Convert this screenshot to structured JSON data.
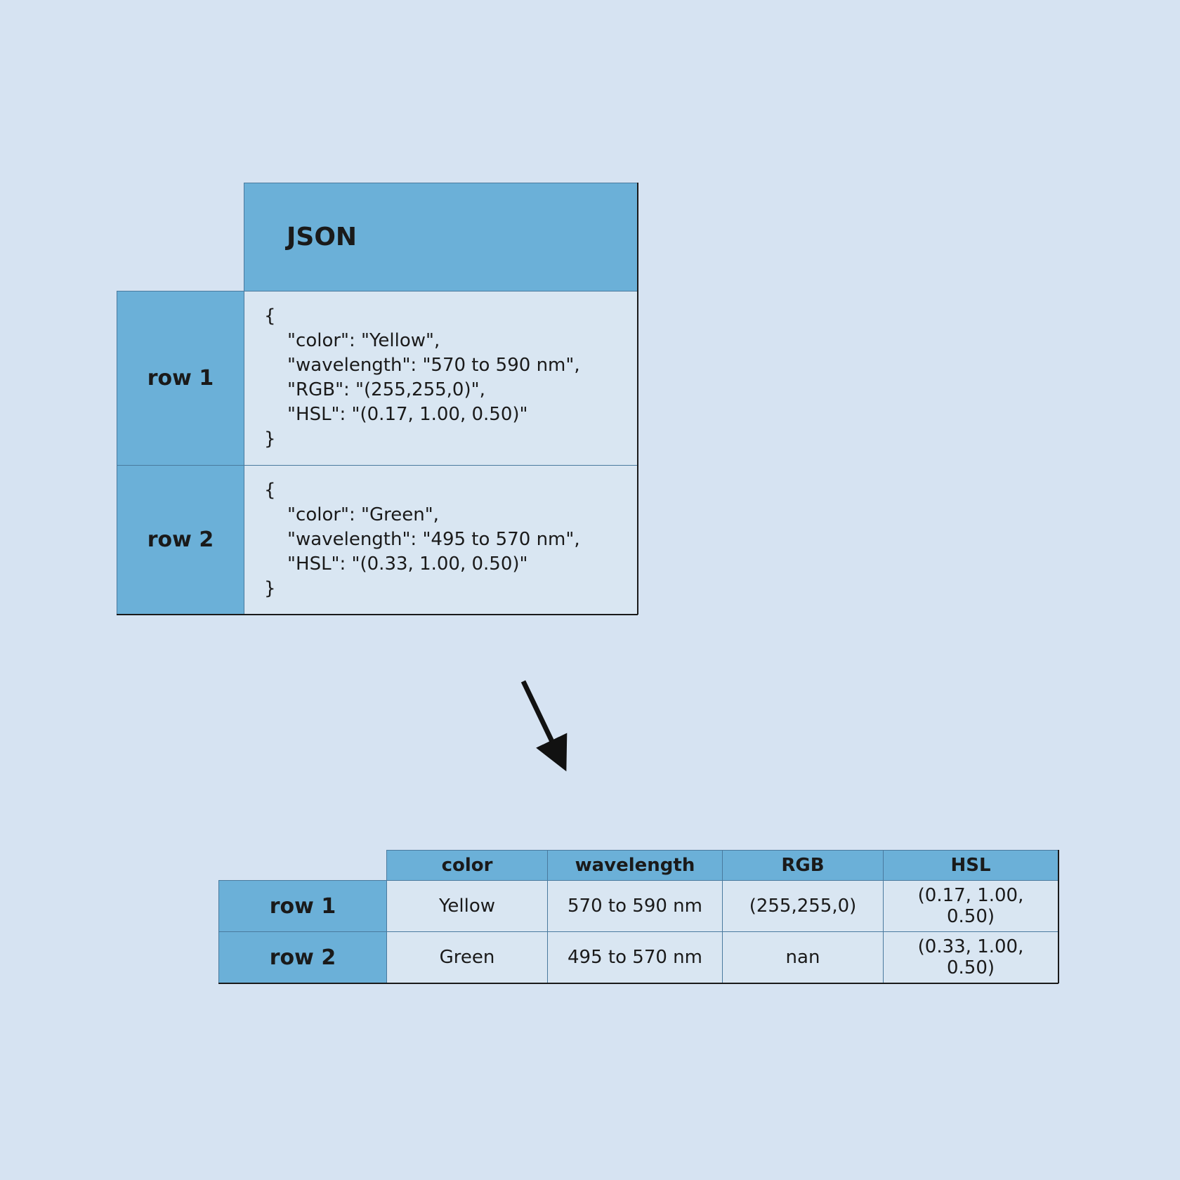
{
  "json_table": {
    "header": "JSON",
    "rows": [
      {
        "label": "row 1",
        "text": "{\n    \"color\": \"Yellow\",\n    \"wavelength\": \"570 to 590 nm\",\n    \"RGB\": \"(255,255,0)\",\n    \"HSL\": \"(0.17, 1.00, 0.50)\"\n}"
      },
      {
        "label": "row 2",
        "text": "{\n    \"color\": \"Green\",\n    \"wavelength\": \"495 to 570 nm\",\n    \"HSL\": \"(0.33, 1.00, 0.50)\"\n}"
      }
    ]
  },
  "out_table": {
    "columns": [
      "color",
      "wavelength",
      "RGB",
      "HSL"
    ],
    "rows": [
      {
        "label": "row 1",
        "cells": [
          "Yellow",
          "570 to 590 nm",
          "(255,255,0)",
          "(0.17, 1.00, 0.50)"
        ]
      },
      {
        "label": "row 2",
        "cells": [
          "Green",
          "495 to 570 nm",
          "nan",
          "(0.33, 1.00, 0.50)"
        ]
      }
    ]
  },
  "colors": {
    "page_bg": "#d6e3f2",
    "header_bg": "#6bb0d8",
    "cell_bg": "#d9e6f2",
    "border": "#4a7a9e",
    "dark": "#1a1a1a"
  }
}
